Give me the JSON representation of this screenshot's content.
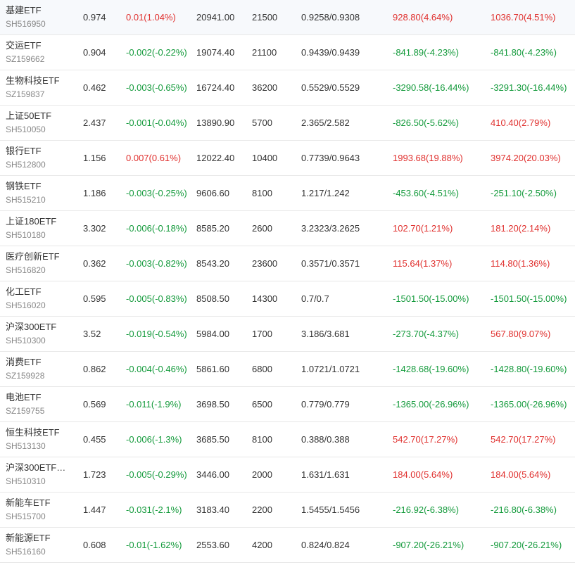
{
  "colors": {
    "up": "#e0302e",
    "down": "#139a3b",
    "text": "#333333",
    "subtext": "#888888",
    "divider": "#e8e8e8"
  },
  "rows": [
    {
      "name": "基建ETF",
      "code": "SH516950",
      "price": "0.974",
      "change": "0.01(1.04%)",
      "change_dir": "up",
      "market_value": "20941.00",
      "quantity": "21500",
      "cost": "0.9258/0.9308",
      "float_pl": "928.80(4.64%)",
      "float_dir": "up",
      "hold_pl": "1036.70(4.51%)",
      "hold_dir": "up"
    },
    {
      "name": "交运ETF",
      "code": "SZ159662",
      "price": "0.904",
      "change": "-0.002(-0.22%)",
      "change_dir": "down",
      "market_value": "19074.40",
      "quantity": "21100",
      "cost": "0.9439/0.9439",
      "float_pl": "-841.89(-4.23%)",
      "float_dir": "down",
      "hold_pl": "-841.80(-4.23%)",
      "hold_dir": "down"
    },
    {
      "name": "生物科技ETF",
      "code": "SZ159837",
      "price": "0.462",
      "change": "-0.003(-0.65%)",
      "change_dir": "down",
      "market_value": "16724.40",
      "quantity": "36200",
      "cost": "0.5529/0.5529",
      "float_pl": "-3290.58(-16.44%)",
      "float_dir": "down",
      "hold_pl": "-3291.30(-16.44%)",
      "hold_dir": "down"
    },
    {
      "name": "上证50ETF",
      "code": "SH510050",
      "price": "2.437",
      "change": "-0.001(-0.04%)",
      "change_dir": "down",
      "market_value": "13890.90",
      "quantity": "5700",
      "cost": "2.365/2.582",
      "float_pl": "-826.50(-5.62%)",
      "float_dir": "down",
      "hold_pl": "410.40(2.79%)",
      "hold_dir": "up"
    },
    {
      "name": "银行ETF",
      "code": "SH512800",
      "price": "1.156",
      "change": "0.007(0.61%)",
      "change_dir": "up",
      "market_value": "12022.40",
      "quantity": "10400",
      "cost": "0.7739/0.9643",
      "float_pl": "1993.68(19.88%)",
      "float_dir": "up",
      "hold_pl": "3974.20(20.03%)",
      "hold_dir": "up"
    },
    {
      "name": "钢铁ETF",
      "code": "SH515210",
      "price": "1.186",
      "change": "-0.003(-0.25%)",
      "change_dir": "down",
      "market_value": "9606.60",
      "quantity": "8100",
      "cost": "1.217/1.242",
      "float_pl": "-453.60(-4.51%)",
      "float_dir": "down",
      "hold_pl": "-251.10(-2.50%)",
      "hold_dir": "down"
    },
    {
      "name": "上证180ETF",
      "code": "SH510180",
      "price": "3.302",
      "change": "-0.006(-0.18%)",
      "change_dir": "down",
      "market_value": "8585.20",
      "quantity": "2600",
      "cost": "3.2323/3.2625",
      "float_pl": "102.70(1.21%)",
      "float_dir": "up",
      "hold_pl": "181.20(2.14%)",
      "hold_dir": "up"
    },
    {
      "name": "医疗创新ETF",
      "code": "SH516820",
      "price": "0.362",
      "change": "-0.003(-0.82%)",
      "change_dir": "down",
      "market_value": "8543.20",
      "quantity": "23600",
      "cost": "0.3571/0.3571",
      "float_pl": "115.64(1.37%)",
      "float_dir": "up",
      "hold_pl": "114.80(1.36%)",
      "hold_dir": "up"
    },
    {
      "name": "化工ETF",
      "code": "SH516020",
      "price": "0.595",
      "change": "-0.005(-0.83%)",
      "change_dir": "down",
      "market_value": "8508.50",
      "quantity": "14300",
      "cost": "0.7/0.7",
      "float_pl": "-1501.50(-15.00%)",
      "float_dir": "down",
      "hold_pl": "-1501.50(-15.00%)",
      "hold_dir": "down"
    },
    {
      "name": "沪深300ETF",
      "code": "SH510300",
      "price": "3.52",
      "change": "-0.019(-0.54%)",
      "change_dir": "down",
      "market_value": "5984.00",
      "quantity": "1700",
      "cost": "3.186/3.681",
      "float_pl": "-273.70(-4.37%)",
      "float_dir": "down",
      "hold_pl": "567.80(9.07%)",
      "hold_dir": "up"
    },
    {
      "name": "消费ETF",
      "code": "SZ159928",
      "price": "0.862",
      "change": "-0.004(-0.46%)",
      "change_dir": "down",
      "market_value": "5861.60",
      "quantity": "6800",
      "cost": "1.0721/1.0721",
      "float_pl": "-1428.68(-19.60%)",
      "float_dir": "down",
      "hold_pl": "-1428.80(-19.60%)",
      "hold_dir": "down"
    },
    {
      "name": "电池ETF",
      "code": "SZ159755",
      "price": "0.569",
      "change": "-0.011(-1.9%)",
      "change_dir": "down",
      "market_value": "3698.50",
      "quantity": "6500",
      "cost": "0.779/0.779",
      "float_pl": "-1365.00(-26.96%)",
      "float_dir": "down",
      "hold_pl": "-1365.00(-26.96%)",
      "hold_dir": "down"
    },
    {
      "name": "恒生科技ETF",
      "code": "SH513130",
      "price": "0.455",
      "change": "-0.006(-1.3%)",
      "change_dir": "down",
      "market_value": "3685.50",
      "quantity": "8100",
      "cost": "0.388/0.388",
      "float_pl": "542.70(17.27%)",
      "float_dir": "up",
      "hold_pl": "542.70(17.27%)",
      "hold_dir": "up"
    },
    {
      "name": "沪深300ETF…",
      "code": "SH510310",
      "price": "1.723",
      "change": "-0.005(-0.29%)",
      "change_dir": "down",
      "market_value": "3446.00",
      "quantity": "2000",
      "cost": "1.631/1.631",
      "float_pl": "184.00(5.64%)",
      "float_dir": "up",
      "hold_pl": "184.00(5.64%)",
      "hold_dir": "up"
    },
    {
      "name": "新能车ETF",
      "code": "SH515700",
      "price": "1.447",
      "change": "-0.031(-2.1%)",
      "change_dir": "down",
      "market_value": "3183.40",
      "quantity": "2200",
      "cost": "1.5455/1.5456",
      "float_pl": "-216.92(-6.38%)",
      "float_dir": "down",
      "hold_pl": "-216.80(-6.38%)",
      "hold_dir": "down"
    },
    {
      "name": "新能源ETF",
      "code": "SH516160",
      "price": "0.608",
      "change": "-0.01(-1.62%)",
      "change_dir": "down",
      "market_value": "2553.60",
      "quantity": "4200",
      "cost": "0.824/0.824",
      "float_pl": "-907.20(-26.21%)",
      "float_dir": "down",
      "hold_pl": "-907.20(-26.21%)",
      "hold_dir": "down"
    }
  ]
}
